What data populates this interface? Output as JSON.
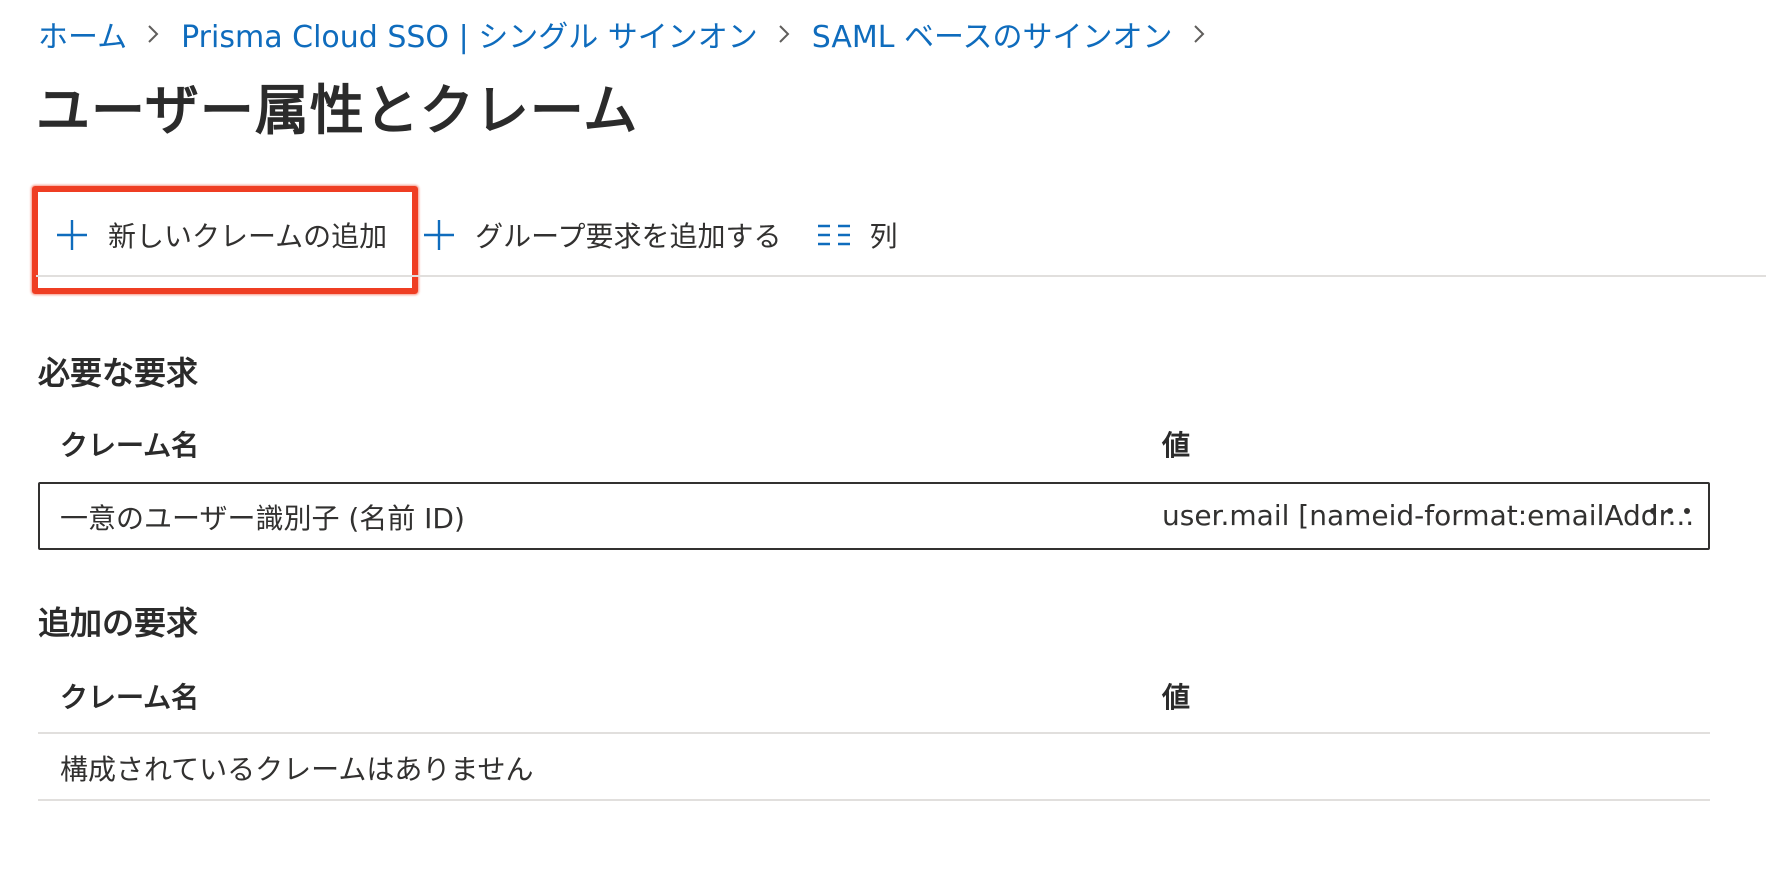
{
  "breadcrumb": {
    "items": [
      "ホーム",
      "Prisma Cloud SSO | シングル サインオン",
      "SAML ベースのサインオン"
    ]
  },
  "page": {
    "title": "ユーザー属性とクレーム"
  },
  "toolbar": {
    "add_claim_label": "新しいクレームの追加",
    "add_group_claim_label": "グループ要求を追加する",
    "columns_label": "列"
  },
  "required_claims": {
    "title": "必要な要求",
    "headers": {
      "name": "クレーム名",
      "value": "値"
    },
    "rows": [
      {
        "name": "一意のユーザー識別子 (名前 ID)",
        "value": "user.mail [nameid-format:emailAddr..."
      }
    ]
  },
  "additional_claims": {
    "title": "追加の要求",
    "headers": {
      "name": "クレーム名",
      "value": "値"
    },
    "empty_message": "構成されているクレームはありません"
  },
  "colors": {
    "link": "#0f6cbd",
    "highlight": "#ef3e23",
    "text": "#323130",
    "divider": "#e1dfdd"
  },
  "icons": [
    "chevron-right-icon",
    "plus-icon",
    "columns-icon",
    "more-icon"
  ]
}
